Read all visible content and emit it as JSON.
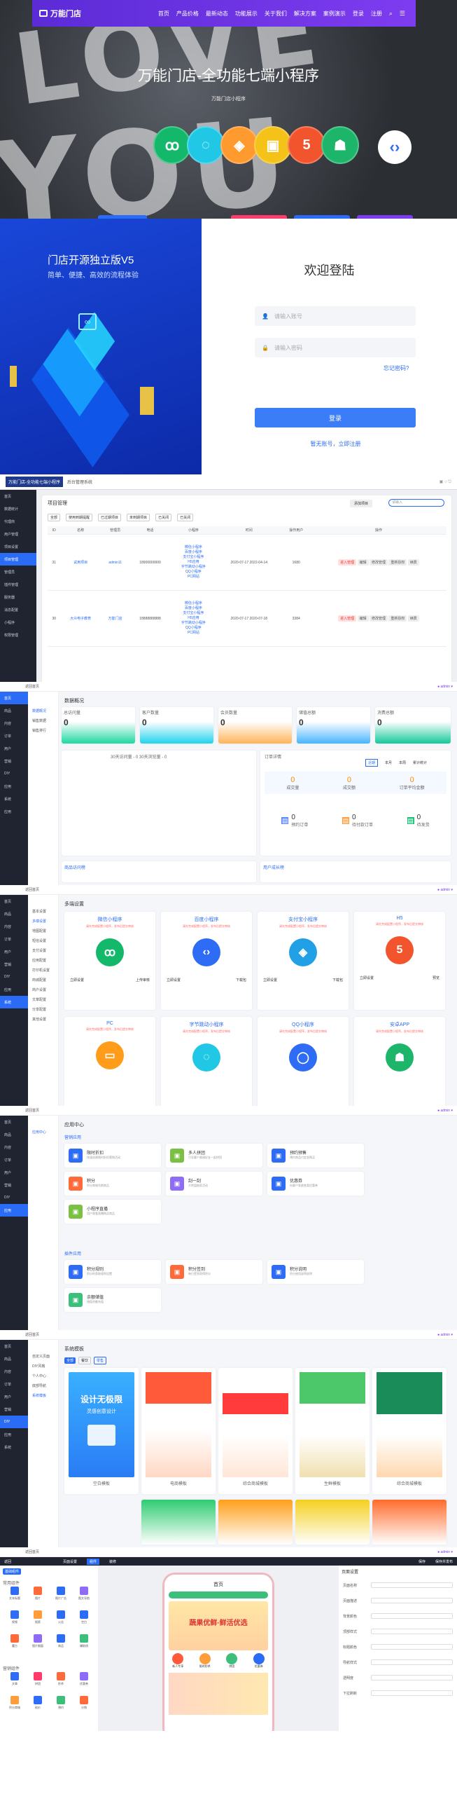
{
  "nav": {
    "logo": "万能门店",
    "items": [
      "首页",
      "产品价格",
      "最新动态",
      "功能展示",
      "关于我们",
      "解决方案",
      "案例演示",
      "登录",
      "注册"
    ]
  },
  "hero": {
    "title": "万能门店-全功能七端小程序",
    "subtitle": "万能门店小程序"
  },
  "login": {
    "left_title": "门店开源独立版V5",
    "left_sub": "简单、便捷、高效的流程体验",
    "title": "欢迎登陆",
    "user_ph": "请输入账号",
    "pass_ph": "请输入密码",
    "forgot": "忘记密码?",
    "submit": "登录",
    "register": "暂无账号，立即注册"
  },
  "s3": {
    "title": "万能门店-全功能七端小程序",
    "subtitle": "后台管理系统",
    "panel_title": "项目管理",
    "btn_add": "添加项目",
    "search_ph": "请输入",
    "filters": [
      "全部",
      "使用到期提醒",
      "已过期项目",
      "未到期项目",
      "已关闭",
      "已关闭"
    ],
    "headers": [
      "ID",
      "名称",
      "管理员",
      "电话",
      "小程序",
      "时间",
      "操作用户",
      "操作"
    ],
    "rows": [
      {
        "id": "31",
        "name": "试用项目",
        "admin": "admin11",
        "phone": "18900000000",
        "apps": [
          "微信小程序",
          "百度小程序",
          "支付宝小程序",
          "H5应用",
          "字节跳动小程序",
          "QQ小程序",
          "PC网站"
        ],
        "time": "2020-07-17 2022-04-14",
        "uid": "1680",
        "ops": [
          "进入管理",
          "编辑",
          "修改管理",
          "重新授权",
          "续费"
        ]
      },
      {
        "id": "30",
        "name": "大众电子教育",
        "admin": "万能门店",
        "phone": "18888888888",
        "apps": [
          "微信小程序",
          "百度小程序",
          "支付宝小程序",
          "H5应用",
          "字节跳动小程序",
          "QQ小程序",
          "PC网站"
        ],
        "time": "2020-07-17 2020-07-18",
        "uid": "3384",
        "ops": [
          "进入管理",
          "编辑",
          "修改管理",
          "重新授权",
          "续费"
        ]
      }
    ],
    "menu": [
      "首页",
      "数据统计",
      "代理商",
      "用户管理",
      "项目设置",
      "项目管理",
      "管理员",
      "插件管理",
      "服务器",
      "消息配置",
      "小程序",
      "权限管理"
    ],
    "foot": "返回首页"
  },
  "s4": {
    "title": "数据概况",
    "stats": [
      {
        "label": "总访问量",
        "value": "0"
      },
      {
        "label": "客户数量",
        "value": "0"
      },
      {
        "label": "会员数量",
        "value": "0"
      },
      {
        "label": "储值总额",
        "value": "0"
      },
      {
        "label": "消费总额",
        "value": "0"
      }
    ],
    "chart_legend": "30天访问量 - 0  30天浏览量 - 0",
    "orders_title": "订单详情",
    "order_tabs": [
      "近期",
      "本月",
      "本周",
      "累计统计"
    ],
    "order_stats": [
      {
        "label": "成交量",
        "value": "0"
      },
      {
        "label": "成交额",
        "value": "0"
      },
      {
        "label": "订单平均金额",
        "value": "0"
      }
    ],
    "order_stats2": [
      {
        "label": "预约订单",
        "value": "0"
      },
      {
        "label": "待付款订单",
        "value": "0"
      },
      {
        "label": "待发货",
        "value": "0"
      }
    ],
    "rank1": "商品访问榜",
    "rank2": "用户成长榜",
    "menu": [
      "首页",
      "商品",
      "内容",
      "订单",
      "用户",
      "营销",
      "DIY",
      "应用",
      "系统",
      "应用"
    ],
    "menu2": [
      "数据概况",
      "销售数据",
      "销售排行"
    ],
    "admin": "admin",
    "foot": "返回首页"
  },
  "s5": {
    "title": "多端设置",
    "apps": [
      {
        "name": "微信小程序",
        "desc": "请先完成配置小程序，发布后提交审核",
        "btns": [
          "立即设置",
          "上传审核"
        ]
      },
      {
        "name": "百度小程序",
        "desc": "请先完成配置小程序，发布后提交审核",
        "btns": [
          "立即设置",
          "下载包"
        ]
      },
      {
        "name": "支付宝小程序",
        "desc": "请先完成配置小程序，发布后提交审核",
        "btns": [
          "立即设置",
          "下载包"
        ]
      },
      {
        "name": "H5",
        "desc": "请先完成配置小程序，发布后提交审核",
        "btns": [
          "立即设置",
          "预览"
        ]
      },
      {
        "name": "PC",
        "desc": "请先完成配置小程序，发布后提交审核",
        "btns": []
      },
      {
        "name": "字节跳动小程序",
        "desc": "请先完成配置小程序，发布后提交审核",
        "btns": []
      },
      {
        "name": "QQ小程序",
        "desc": "请先完成配置小程序，发布后提交审核",
        "btns": []
      },
      {
        "name": "安卓APP",
        "desc": "请先完成配置小程序，发布后提交审核",
        "btns": []
      }
    ],
    "menu2": [
      "基本设置",
      "多端设置",
      "地图配置",
      "短信设置",
      "支付设置",
      "应用配置",
      "打印机设置",
      "商城配置",
      "商户设置",
      "文章配置",
      "分享配置",
      "其他设置"
    ],
    "foot": "返回首页"
  },
  "s6": {
    "title": "应用中心",
    "sub": "营销应用",
    "sub2": "插件应用",
    "apps": [
      {
        "name": "限时折扣",
        "desc": "快速创建限时折扣营销活动"
      },
      {
        "name": "多人拼团",
        "desc": "引导客户邀请好友一起拼团"
      },
      {
        "name": "预约预售",
        "desc": "预约商品付定金购买"
      },
      {
        "name": "积分",
        "desc": "积分商城兑换商品"
      },
      {
        "name": "刮一刮",
        "desc": "大转盘抽奖活动"
      },
      {
        "name": "优惠券",
        "desc": "向客户发放各类优惠券"
      },
      {
        "name": "小程序直播",
        "desc": "用户观看直播购买商品"
      },
      {
        "name": "积分规则",
        "desc": "积分的获取规则设置"
      },
      {
        "name": "积分签到",
        "desc": "每日签到获得积分"
      },
      {
        "name": "积分说明",
        "desc": "积分使用说明说明"
      },
      {
        "name": "余额储值",
        "desc": "储值余额充值"
      }
    ],
    "foot": "返回首页"
  },
  "s7": {
    "title": "系统模板",
    "tabs": [
      "全部",
      "餐饮",
      "零售"
    ],
    "templates": [
      "空白模板",
      "电商模板",
      "综合商城模板",
      "生鲜模板",
      "综合商城模板"
    ],
    "banner": "设计无极限",
    "banner2": "灵感创意设计",
    "menu2": [
      "自定义页面",
      "DIY风格",
      "个人中心",
      "底部导航",
      "系统模板"
    ],
    "foot": "返回首页"
  },
  "s8": {
    "top": [
      "返回",
      "页面设置",
      "组件",
      "装修",
      "保存"
    ],
    "left_title": "基础组件",
    "groups": [
      "常用组件",
      "营销组件"
    ],
    "comps": [
      "文本标题",
      "图片",
      "图片广告",
      "图文导航",
      "视频",
      "搜索",
      "公告",
      "空白",
      "魔方",
      "图片橱窗",
      "商品",
      "辅助线",
      "文章",
      "拼团",
      "秒杀",
      "优惠券",
      "积分商城",
      "砍价",
      "预约",
      "分销"
    ],
    "phone_title": "首页",
    "phone_banner": "蔬果优鲜·鲜活优选",
    "phone_tags": [
      "新人专享",
      "限时秒杀",
      "拼团",
      "优惠券"
    ],
    "right_title": "页面设置",
    "right_items": [
      "页面名称",
      "页面描述",
      "背景颜色",
      "顶部样式",
      "标题颜色",
      "导航样式",
      "透明度",
      "下拉刷新"
    ],
    "save": "保存并发布"
  }
}
